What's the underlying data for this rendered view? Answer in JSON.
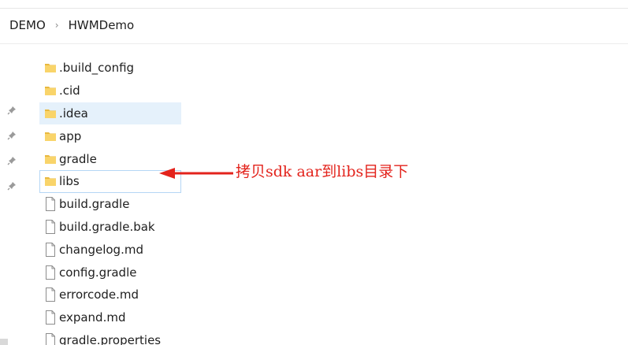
{
  "breadcrumb": {
    "items": [
      "DEMO",
      "HWMDemo"
    ],
    "separator": "›"
  },
  "files": [
    {
      "name": ".build_config",
      "type": "folder"
    },
    {
      "name": ".cid",
      "type": "folder"
    },
    {
      "name": ".idea",
      "type": "folder",
      "selected": true
    },
    {
      "name": "app",
      "type": "folder"
    },
    {
      "name": "gradle",
      "type": "folder"
    },
    {
      "name": "libs",
      "type": "folder",
      "focused": true
    },
    {
      "name": "build.gradle",
      "type": "file"
    },
    {
      "name": "build.gradle.bak",
      "type": "file"
    },
    {
      "name": "changelog.md",
      "type": "file"
    },
    {
      "name": "config.gradle",
      "type": "file"
    },
    {
      "name": "errorcode.md",
      "type": "file"
    },
    {
      "name": "expand.md",
      "type": "file"
    },
    {
      "name": "gradle.properties",
      "type": "file"
    }
  ],
  "annotation": {
    "text": "拷贝sdk aar到libs目录下",
    "color": "#e3231c"
  },
  "colors": {
    "folder": "#f9d46a",
    "folder_dark": "#e8b83f",
    "selected_bg": "#e5f1fb",
    "focus_border": "#b5d6f5"
  }
}
